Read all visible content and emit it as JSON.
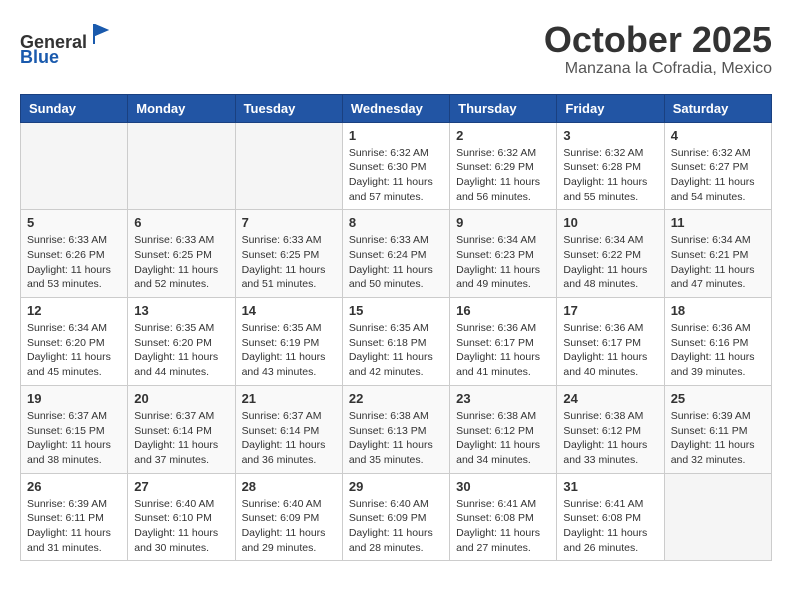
{
  "header": {
    "logo_line1": "General",
    "logo_line2": "Blue",
    "month": "October 2025",
    "location": "Manzana la Cofradia, Mexico"
  },
  "days_of_week": [
    "Sunday",
    "Monday",
    "Tuesday",
    "Wednesday",
    "Thursday",
    "Friday",
    "Saturday"
  ],
  "weeks": [
    [
      {
        "day": "",
        "info": ""
      },
      {
        "day": "",
        "info": ""
      },
      {
        "day": "",
        "info": ""
      },
      {
        "day": "1",
        "info": "Sunrise: 6:32 AM\nSunset: 6:30 PM\nDaylight: 11 hours\nand 57 minutes."
      },
      {
        "day": "2",
        "info": "Sunrise: 6:32 AM\nSunset: 6:29 PM\nDaylight: 11 hours\nand 56 minutes."
      },
      {
        "day": "3",
        "info": "Sunrise: 6:32 AM\nSunset: 6:28 PM\nDaylight: 11 hours\nand 55 minutes."
      },
      {
        "day": "4",
        "info": "Sunrise: 6:32 AM\nSunset: 6:27 PM\nDaylight: 11 hours\nand 54 minutes."
      }
    ],
    [
      {
        "day": "5",
        "info": "Sunrise: 6:33 AM\nSunset: 6:26 PM\nDaylight: 11 hours\nand 53 minutes."
      },
      {
        "day": "6",
        "info": "Sunrise: 6:33 AM\nSunset: 6:25 PM\nDaylight: 11 hours\nand 52 minutes."
      },
      {
        "day": "7",
        "info": "Sunrise: 6:33 AM\nSunset: 6:25 PM\nDaylight: 11 hours\nand 51 minutes."
      },
      {
        "day": "8",
        "info": "Sunrise: 6:33 AM\nSunset: 6:24 PM\nDaylight: 11 hours\nand 50 minutes."
      },
      {
        "day": "9",
        "info": "Sunrise: 6:34 AM\nSunset: 6:23 PM\nDaylight: 11 hours\nand 49 minutes."
      },
      {
        "day": "10",
        "info": "Sunrise: 6:34 AM\nSunset: 6:22 PM\nDaylight: 11 hours\nand 48 minutes."
      },
      {
        "day": "11",
        "info": "Sunrise: 6:34 AM\nSunset: 6:21 PM\nDaylight: 11 hours\nand 47 minutes."
      }
    ],
    [
      {
        "day": "12",
        "info": "Sunrise: 6:34 AM\nSunset: 6:20 PM\nDaylight: 11 hours\nand 45 minutes."
      },
      {
        "day": "13",
        "info": "Sunrise: 6:35 AM\nSunset: 6:20 PM\nDaylight: 11 hours\nand 44 minutes."
      },
      {
        "day": "14",
        "info": "Sunrise: 6:35 AM\nSunset: 6:19 PM\nDaylight: 11 hours\nand 43 minutes."
      },
      {
        "day": "15",
        "info": "Sunrise: 6:35 AM\nSunset: 6:18 PM\nDaylight: 11 hours\nand 42 minutes."
      },
      {
        "day": "16",
        "info": "Sunrise: 6:36 AM\nSunset: 6:17 PM\nDaylight: 11 hours\nand 41 minutes."
      },
      {
        "day": "17",
        "info": "Sunrise: 6:36 AM\nSunset: 6:17 PM\nDaylight: 11 hours\nand 40 minutes."
      },
      {
        "day": "18",
        "info": "Sunrise: 6:36 AM\nSunset: 6:16 PM\nDaylight: 11 hours\nand 39 minutes."
      }
    ],
    [
      {
        "day": "19",
        "info": "Sunrise: 6:37 AM\nSunset: 6:15 PM\nDaylight: 11 hours\nand 38 minutes."
      },
      {
        "day": "20",
        "info": "Sunrise: 6:37 AM\nSunset: 6:14 PM\nDaylight: 11 hours\nand 37 minutes."
      },
      {
        "day": "21",
        "info": "Sunrise: 6:37 AM\nSunset: 6:14 PM\nDaylight: 11 hours\nand 36 minutes."
      },
      {
        "day": "22",
        "info": "Sunrise: 6:38 AM\nSunset: 6:13 PM\nDaylight: 11 hours\nand 35 minutes."
      },
      {
        "day": "23",
        "info": "Sunrise: 6:38 AM\nSunset: 6:12 PM\nDaylight: 11 hours\nand 34 minutes."
      },
      {
        "day": "24",
        "info": "Sunrise: 6:38 AM\nSunset: 6:12 PM\nDaylight: 11 hours\nand 33 minutes."
      },
      {
        "day": "25",
        "info": "Sunrise: 6:39 AM\nSunset: 6:11 PM\nDaylight: 11 hours\nand 32 minutes."
      }
    ],
    [
      {
        "day": "26",
        "info": "Sunrise: 6:39 AM\nSunset: 6:11 PM\nDaylight: 11 hours\nand 31 minutes."
      },
      {
        "day": "27",
        "info": "Sunrise: 6:40 AM\nSunset: 6:10 PM\nDaylight: 11 hours\nand 30 minutes."
      },
      {
        "day": "28",
        "info": "Sunrise: 6:40 AM\nSunset: 6:09 PM\nDaylight: 11 hours\nand 29 minutes."
      },
      {
        "day": "29",
        "info": "Sunrise: 6:40 AM\nSunset: 6:09 PM\nDaylight: 11 hours\nand 28 minutes."
      },
      {
        "day": "30",
        "info": "Sunrise: 6:41 AM\nSunset: 6:08 PM\nDaylight: 11 hours\nand 27 minutes."
      },
      {
        "day": "31",
        "info": "Sunrise: 6:41 AM\nSunset: 6:08 PM\nDaylight: 11 hours\nand 26 minutes."
      },
      {
        "day": "",
        "info": ""
      }
    ]
  ]
}
